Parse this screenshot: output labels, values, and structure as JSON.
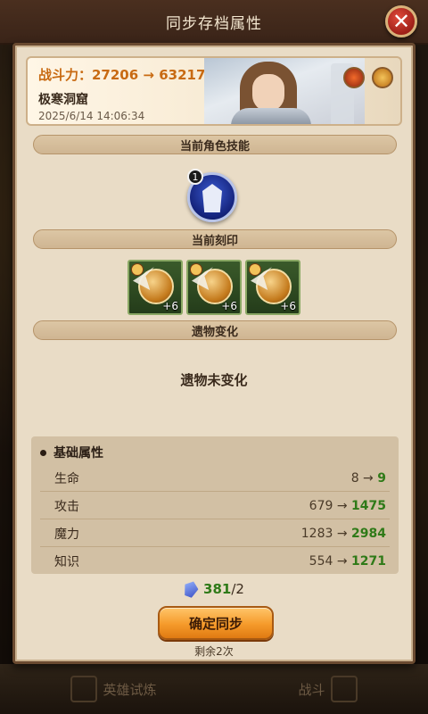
{
  "title": "同步存档属性",
  "hero": {
    "power_text": "战斗力：27206 → 63217",
    "location": "极寒洞窟",
    "date": "2025/6/14 14:06:34"
  },
  "sections": {
    "skills": "当前角色技能",
    "engravings": "当前刻印",
    "relics": "遗物变化"
  },
  "skill": {
    "level": "1"
  },
  "engravings": [
    {
      "level": "+6"
    },
    {
      "level": "+6"
    },
    {
      "level": "+6"
    }
  ],
  "relic_status": "遗物未变化",
  "stats": {
    "title": "基础属性",
    "rows": [
      {
        "name": "生命",
        "old": "8",
        "new": "9"
      },
      {
        "name": "攻击",
        "old": "679",
        "new": "1475"
      },
      {
        "name": "魔力",
        "old": "1283",
        "new": "2984"
      },
      {
        "name": "知识",
        "old": "554",
        "new": "1271"
      }
    ]
  },
  "cost": {
    "have": "381",
    "need": "/2"
  },
  "confirm_label": "确定同步",
  "remaining": "剩余2次",
  "bottom_nav": {
    "left": "英雄试炼",
    "right": "战斗"
  },
  "colors": {
    "accent": "#f59a2a",
    "increase": "#2f7a18",
    "power": "#c86a12"
  }
}
